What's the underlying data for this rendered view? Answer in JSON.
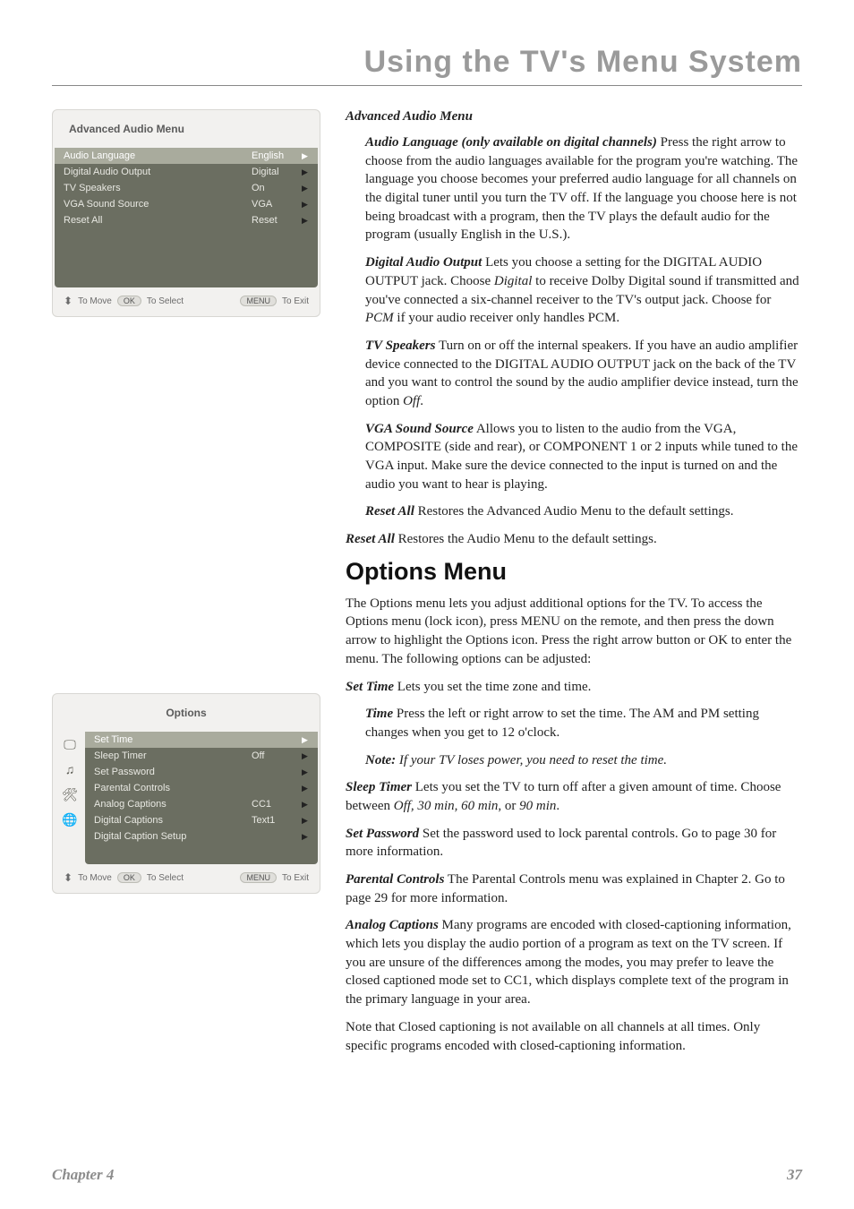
{
  "header": "Using the TV's Menu System",
  "menu1": {
    "title": "Advanced Audio Menu",
    "rows": [
      {
        "label": "Audio Language",
        "val": "English",
        "sel": true
      },
      {
        "label": "Digital Audio Output",
        "val": "Digital"
      },
      {
        "label": "TV Speakers",
        "val": "On"
      },
      {
        "label": "VGA Sound Source",
        "val": "VGA"
      },
      {
        "label": "Reset All",
        "val": "Reset"
      }
    ],
    "nav": {
      "move": "To Move",
      "ok": "OK",
      "select": "To Select",
      "menu": "MENU",
      "exit": "To Exit"
    }
  },
  "menu2": {
    "title": "Options",
    "rows": [
      {
        "label": "Set Time",
        "val": "",
        "sel": true
      },
      {
        "label": "Sleep Timer",
        "val": "Off"
      },
      {
        "label": "Set Password",
        "val": ""
      },
      {
        "label": "Parental Controls",
        "val": ""
      },
      {
        "label": "Analog Captions",
        "val": "CC1"
      },
      {
        "label": "Digital Captions",
        "val": "Text1"
      },
      {
        "label": "Digital Caption Setup",
        "val": ""
      }
    ],
    "nav": {
      "move": "To Move",
      "ok": "OK",
      "select": "To Select",
      "menu": "MENU",
      "exit": "To Exit"
    }
  },
  "content": {
    "advanced_title": "Advanced Audio Menu",
    "audio_lang_term": "Audio Language (only available on digital channels)",
    "audio_lang_text": " Press the right arrow to choose from the audio languages available for the program you're watching. The language you choose becomes your preferred audio language for all channels on the digital tuner until you turn the TV off. If the language you choose here is not being broadcast with a program, then the TV plays the default audio for the program (usually English in the U.S.).",
    "dao_term": "Digital Audio Output",
    "dao_text_1": " Lets you choose a setting for the DIGITAL AUDIO OUTPUT jack. Choose ",
    "dao_i1": "Digital",
    "dao_text_2": " to receive Dolby Digital sound if transmitted and you've connected a six-channel receiver to the TV's output jack. Choose for ",
    "dao_i2": "PCM",
    "dao_text_3": " if your audio receiver only handles PCM.",
    "tvs_term": "TV Speakers",
    "tvs_text_1": " Turn on or off the internal speakers. If you have an audio amplifier device connected to the DIGITAL AUDIO OUTPUT jack on the back of the TV and you want to control the sound by the audio amplifier device instead, turn the option ",
    "tvs_i1": "Off",
    "tvs_text_2": ".",
    "vga_term": "VGA Sound Source",
    "vga_text": " Allows you to listen to the audio from the VGA, COMPOSITE (side and rear), or COMPONENT 1 or 2 inputs while tuned to the VGA input. Make sure the device connected to the input is turned on and the audio you want to hear is playing.",
    "reset1_term": "Reset All",
    "reset1_text": " Restores the Advanced Audio Menu to the default settings.",
    "reset2_term": "Reset All",
    "reset2_text": " Restores the Audio Menu to the default settings.",
    "options_h2": "Options Menu",
    "options_intro": "The Options menu lets you adjust additional options for the TV. To access the Options menu (lock icon), press MENU on the remote, and then press the down arrow to highlight the Options icon. Press the right arrow button or OK to enter the menu. The following options can be adjusted:",
    "settime_term": "Set Time",
    "settime_text": " Lets you set the time zone and time.",
    "time_term": "Time",
    "time_text": " Press the left or right arrow to set the time. The AM and PM setting changes when you get to 12 o'clock.",
    "note_term": "Note:",
    "note_text": " If your TV loses power, you need to reset the time.",
    "sleep_term": "Sleep Timer",
    "sleep_text_1": " Lets you set the TV to turn off after a given amount of time. Choose between ",
    "sleep_i1": "Off, 30 min, 60 min",
    "sleep_text_2": ", or ",
    "sleep_i2": "90 min",
    "sleep_text_3": ".",
    "pw_term": "Set Password",
    "pw_text": " Set the password used to lock parental controls. Go to page 30 for more information.",
    "pc_term": "Parental Controls",
    "pc_text": " The Parental Controls menu was explained in Chapter 2. Go to page 29 for more information.",
    "ac_term": "Analog Captions",
    "ac_text": " Many programs are encoded with closed-captioning information, which lets you display the audio portion of a program as text on the TV screen. If you are unsure of the differences among the modes, you may prefer to leave the closed captioned mode set to CC1, which displays complete text of the program in the primary language in your area.",
    "ac_note": "Note that Closed captioning is not available on all channels at all times. Only specific programs encoded with closed-captioning information."
  },
  "footer": {
    "left": "Chapter 4",
    "right": "37"
  }
}
